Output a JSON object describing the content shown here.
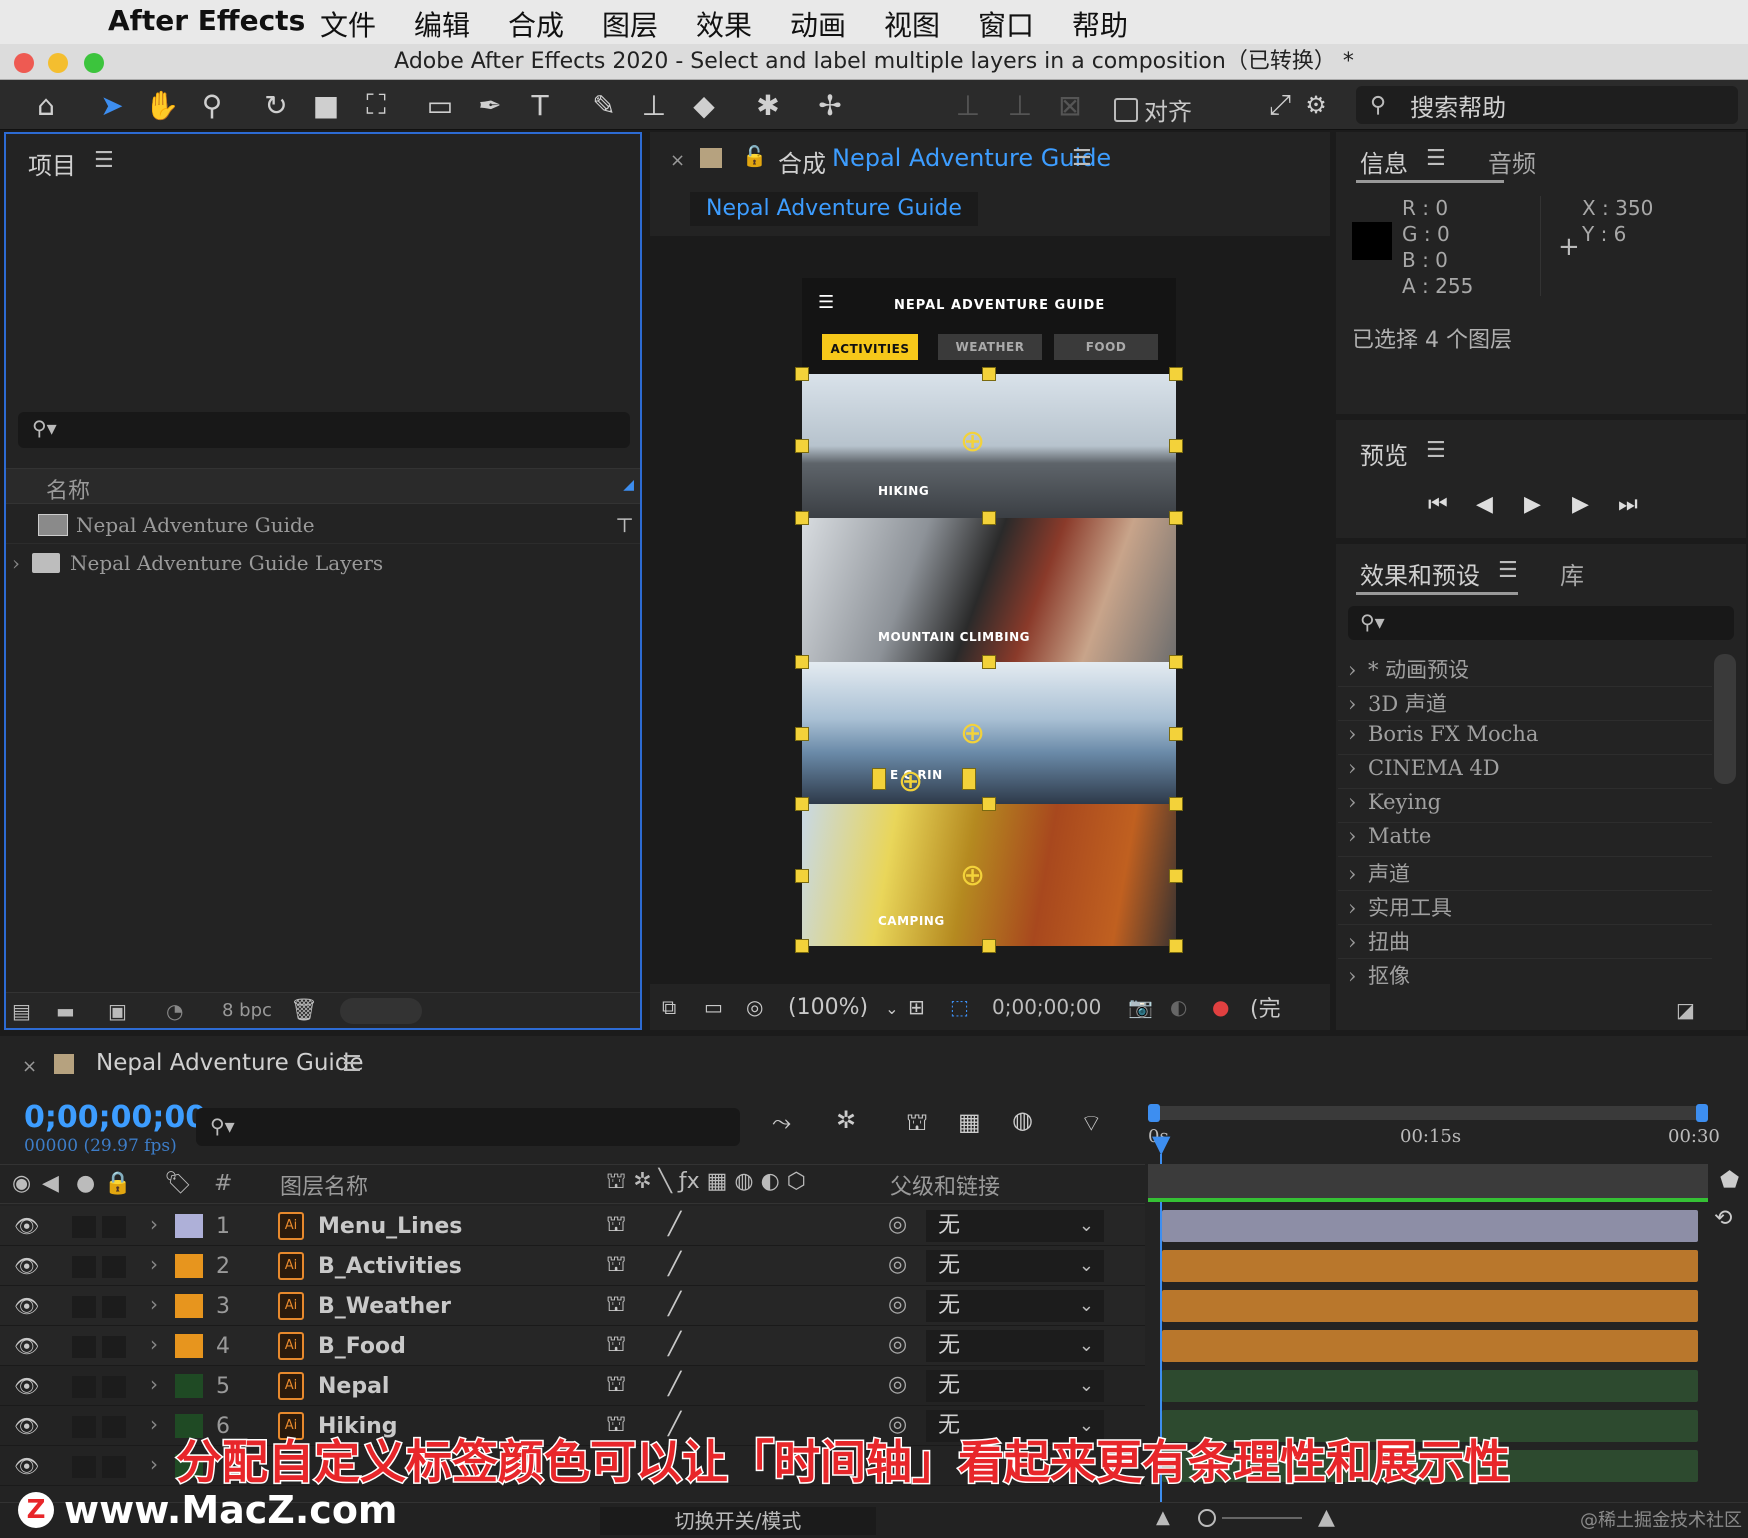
{
  "menubar": {
    "apple": "",
    "app": "After Effects",
    "items": [
      "文件",
      "编辑",
      "合成",
      "图层",
      "效果",
      "动画",
      "视图",
      "窗口",
      "帮助"
    ]
  },
  "window_title": "Adobe After Effects 2020 - Select and label multiple layers in a composition（已转换） *",
  "toolbar": {
    "align_label": "对齐",
    "search_help": "搜索帮助"
  },
  "project": {
    "title": "项目",
    "col_name": "名称",
    "items": [
      "Nepal Adventure Guide",
      "Nepal Adventure Guide Layers"
    ],
    "bpc": "8 bpc"
  },
  "comp": {
    "tab_prefix": "合成",
    "tab_name": "Nepal Adventure Guide",
    "breadcrumb": "Nepal Adventure Guide",
    "zoom": "(100%)",
    "timecode": "0;00;00;00",
    "quality": "(完"
  },
  "phone": {
    "title": "NEPAL ADVENTURE GUIDE",
    "tabs": [
      "ACTIVITIES",
      "WEATHER",
      "FOOD"
    ],
    "photos": [
      "HIKING",
      "MOUNTAIN CLIMBING",
      "E  C    RIN",
      "CAMPING"
    ]
  },
  "info": {
    "tab1": "信息",
    "tab2": "音频",
    "r": "R :  0",
    "g": "G :  0",
    "b": "B :  0",
    "a": "A :  255",
    "x": "X : 350",
    "y": "Y :  6",
    "status": "已选择 4 个图层"
  },
  "preview": {
    "title": "预览"
  },
  "effects": {
    "tab1": "效果和预设",
    "tab2": "库",
    "items": [
      "* 动画预设",
      "3D 声道",
      "Boris FX Mocha",
      "CINEMA 4D",
      "Keying",
      "Matte",
      "声道",
      "实用工具",
      "扭曲",
      "抠像"
    ]
  },
  "timeline": {
    "tab_name": "Nepal Adventure Guide",
    "timecode": "0;00;00;00",
    "fps": "00000 (29.97 fps)",
    "col_hash": "#",
    "col_layer": "图层名称",
    "col_parent": "父级和链接",
    "ruler": [
      "0s",
      "00:15s",
      "00:30"
    ],
    "layers": [
      {
        "num": "1",
        "name": "Menu_Lines",
        "parent": "无",
        "label": "#aeb0d8",
        "bar": "#8d8ea6"
      },
      {
        "num": "2",
        "name": "B_Activities",
        "parent": "无",
        "label": "#e7951e",
        "bar": "#b9772c"
      },
      {
        "num": "3",
        "name": "B_Weather",
        "parent": "无",
        "label": "#e7951e",
        "bar": "#b9772c"
      },
      {
        "num": "4",
        "name": "B_Food",
        "parent": "无",
        "label": "#e7951e",
        "bar": "#b9772c"
      },
      {
        "num": "5",
        "name": "Nepal",
        "parent": "无",
        "label": "#1f4a24",
        "bar": "#2d4a2f"
      },
      {
        "num": "6",
        "name": "Hiking",
        "parent": "无",
        "label": "#1f4a24",
        "bar": "#2d4a2f"
      },
      {
        "num": "7",
        "name": "",
        "parent": "",
        "label": "#1f4a24",
        "bar": "#2d4a2f"
      }
    ],
    "footer_toggle": "切换开关/模式"
  },
  "overlay": {
    "caption": "分配自定义标签颜色可以让「时间轴」看起来更有条理性和展示性",
    "watermark": "www.MacZ.com",
    "credit": "@稀土掘金技术社区"
  }
}
